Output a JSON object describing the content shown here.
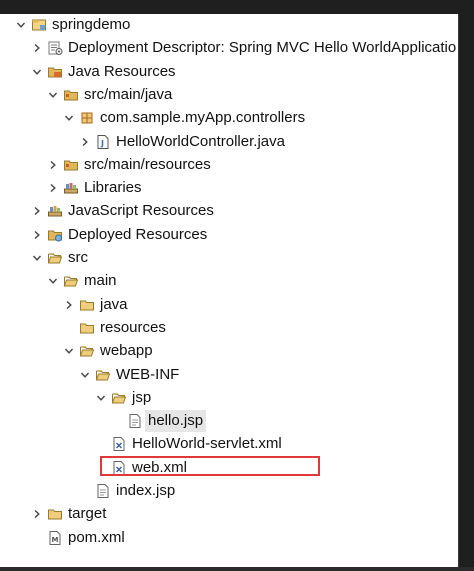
{
  "tree": {
    "items": [
      {
        "label": "springdemo",
        "depth": 0,
        "expand": "open",
        "icon": "project-icon",
        "name": "tree-item-springdemo"
      },
      {
        "label": "Deployment Descriptor: Spring MVC Hello WorldApplicatio",
        "depth": 1,
        "expand": "closed",
        "icon": "deployment-descriptor-icon",
        "name": "tree-item-deployment-descriptor"
      },
      {
        "label": "Java Resources",
        "depth": 1,
        "expand": "open",
        "icon": "java-resources-icon",
        "name": "tree-item-java-resources"
      },
      {
        "label": "src/main/java",
        "depth": 2,
        "expand": "open",
        "icon": "source-folder-icon",
        "name": "tree-item-src-main-java"
      },
      {
        "label": "com.sample.myApp.controllers",
        "depth": 3,
        "expand": "open",
        "icon": "package-icon",
        "name": "tree-item-package-controllers"
      },
      {
        "label": "HelloWorldController.java",
        "depth": 4,
        "expand": "closed",
        "icon": "java-file-icon",
        "name": "tree-item-helloworldcontroller-java"
      },
      {
        "label": "src/main/resources",
        "depth": 2,
        "expand": "closed",
        "icon": "source-folder-icon",
        "name": "tree-item-src-main-resources"
      },
      {
        "label": "Libraries",
        "depth": 2,
        "expand": "closed",
        "icon": "libraries-icon",
        "name": "tree-item-libraries"
      },
      {
        "label": "JavaScript Resources",
        "depth": 1,
        "expand": "closed",
        "icon": "javascript-resources-icon",
        "name": "tree-item-javascript-resources"
      },
      {
        "label": "Deployed Resources",
        "depth": 1,
        "expand": "closed",
        "icon": "deployed-resources-icon",
        "name": "tree-item-deployed-resources"
      },
      {
        "label": "src",
        "depth": 1,
        "expand": "open",
        "icon": "folder-open-icon",
        "name": "tree-item-src"
      },
      {
        "label": "main",
        "depth": 2,
        "expand": "open",
        "icon": "folder-open-icon",
        "name": "tree-item-main"
      },
      {
        "label": "java",
        "depth": 3,
        "expand": "closed",
        "icon": "folder-icon",
        "name": "tree-item-java"
      },
      {
        "label": "resources",
        "depth": 3,
        "expand": "none",
        "icon": "folder-icon",
        "name": "tree-item-resources"
      },
      {
        "label": "webapp",
        "depth": 3,
        "expand": "open",
        "icon": "folder-open-icon",
        "name": "tree-item-webapp"
      },
      {
        "label": "WEB-INF",
        "depth": 4,
        "expand": "open",
        "icon": "folder-open-icon",
        "name": "tree-item-web-inf"
      },
      {
        "label": "jsp",
        "depth": 5,
        "expand": "open",
        "icon": "folder-open-icon",
        "name": "tree-item-jsp"
      },
      {
        "label": "hello.jsp",
        "depth": 6,
        "expand": "none",
        "icon": "jsp-file-icon",
        "name": "tree-item-hello-jsp",
        "selected": true
      },
      {
        "label": "HelloWorld-servlet.xml",
        "depth": 5,
        "expand": "none",
        "icon": "xml-file-icon",
        "name": "tree-item-helloworld-servlet-xml"
      },
      {
        "label": "web.xml",
        "depth": 5,
        "expand": "none",
        "icon": "xml-file-icon",
        "name": "tree-item-web-xml"
      },
      {
        "label": "index.jsp",
        "depth": 4,
        "expand": "none",
        "icon": "jsp-file-icon",
        "name": "tree-item-index-jsp"
      },
      {
        "label": "target",
        "depth": 1,
        "expand": "closed",
        "icon": "folder-icon",
        "name": "tree-item-target"
      },
      {
        "label": "pom.xml",
        "depth": 1,
        "expand": "none",
        "icon": "maven-pom-icon",
        "name": "tree-item-pom-xml"
      }
    ]
  },
  "colors": {
    "highlight_border": "#e0393b",
    "folder": "#e2b65a",
    "selection": "#e6e6e6"
  }
}
